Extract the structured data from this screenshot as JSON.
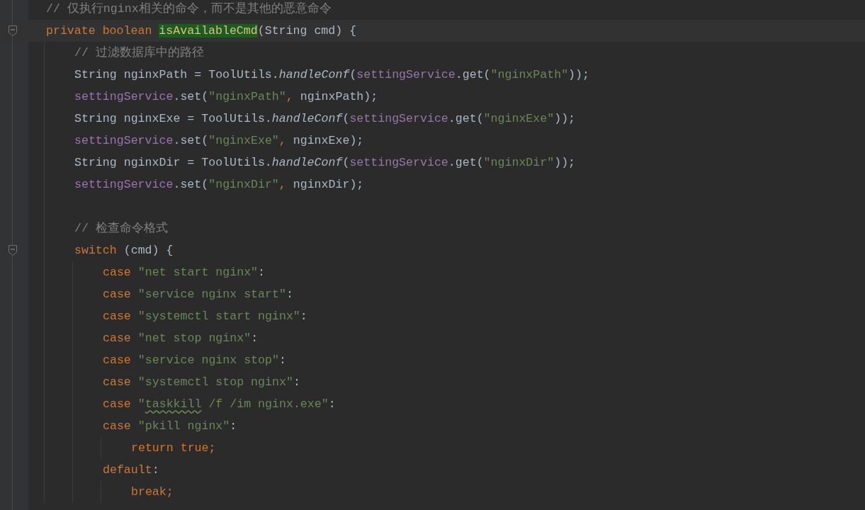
{
  "editor": {
    "lines": [
      {
        "tokens": [
          {
            "kind": "comment",
            "text": "// 仅执行nginx相关的命令，而不是其他的恶意命令"
          }
        ]
      },
      {
        "current": true,
        "foldable": true,
        "tokens": [
          {
            "kind": "keyword",
            "text": "private boolean "
          },
          {
            "kind": "plain",
            "text": "isAvailableCmd",
            "highlighted": true
          },
          {
            "kind": "plain",
            "text": "(String cmd) {"
          }
        ],
        "children": [
          {
            "tokens": [
              {
                "kind": "comment",
                "text": "// 过滤数据库中的路径"
              }
            ]
          },
          {
            "tokens": [
              {
                "kind": "plain",
                "text": "String nginxPath = ToolUtils."
              },
              {
                "kind": "static",
                "text": "handleConf"
              },
              {
                "kind": "plain",
                "text": "("
              },
              {
                "kind": "field",
                "text": "settingService"
              },
              {
                "kind": "plain",
                "text": ".get("
              },
              {
                "kind": "string",
                "text": "\"nginxPath\""
              },
              {
                "kind": "plain",
                "text": "));"
              }
            ]
          },
          {
            "tokens": [
              {
                "kind": "field",
                "text": "settingService"
              },
              {
                "kind": "plain",
                "text": ".set("
              },
              {
                "kind": "string",
                "text": "\"nginxPath\""
              },
              {
                "kind": "keyword",
                "text": ", "
              },
              {
                "kind": "plain",
                "text": "nginxPath);"
              }
            ]
          },
          {
            "tokens": [
              {
                "kind": "plain",
                "text": "String nginxExe = ToolUtils."
              },
              {
                "kind": "static",
                "text": "handleConf"
              },
              {
                "kind": "plain",
                "text": "("
              },
              {
                "kind": "field",
                "text": "settingService"
              },
              {
                "kind": "plain",
                "text": ".get("
              },
              {
                "kind": "string",
                "text": "\"nginxExe\""
              },
              {
                "kind": "plain",
                "text": "));"
              }
            ]
          },
          {
            "tokens": [
              {
                "kind": "field",
                "text": "settingService"
              },
              {
                "kind": "plain",
                "text": ".set("
              },
              {
                "kind": "string",
                "text": "\"nginxExe\""
              },
              {
                "kind": "keyword",
                "text": ", "
              },
              {
                "kind": "plain",
                "text": "nginxExe);"
              }
            ]
          },
          {
            "tokens": [
              {
                "kind": "plain",
                "text": "String nginxDir = ToolUtils."
              },
              {
                "kind": "static",
                "text": "handleConf"
              },
              {
                "kind": "plain",
                "text": "("
              },
              {
                "kind": "field",
                "text": "settingService"
              },
              {
                "kind": "plain",
                "text": ".get("
              },
              {
                "kind": "string",
                "text": "\"nginxDir\""
              },
              {
                "kind": "plain",
                "text": "));"
              }
            ]
          },
          {
            "tokens": [
              {
                "kind": "field",
                "text": "settingService"
              },
              {
                "kind": "plain",
                "text": ".set("
              },
              {
                "kind": "string",
                "text": "\"nginxDir\""
              },
              {
                "kind": "keyword",
                "text": ", "
              },
              {
                "kind": "plain",
                "text": "nginxDir);"
              }
            ]
          },
          {
            "gap_before": true,
            "tokens": [
              {
                "kind": "comment",
                "text": "// 检查命令格式"
              }
            ]
          },
          {
            "foldable": true,
            "tokens": [
              {
                "kind": "keyword",
                "text": "switch "
              },
              {
                "kind": "plain",
                "text": "(cmd) {"
              }
            ],
            "children": [
              {
                "tokens": [
                  {
                    "kind": "keyword",
                    "text": "case "
                  },
                  {
                    "kind": "string",
                    "text": "\"net start nginx\""
                  },
                  {
                    "kind": "plain",
                    "text": ":"
                  }
                ]
              },
              {
                "tokens": [
                  {
                    "kind": "keyword",
                    "text": "case "
                  },
                  {
                    "kind": "string",
                    "text": "\"service nginx start\""
                  },
                  {
                    "kind": "plain",
                    "text": ":"
                  }
                ]
              },
              {
                "tokens": [
                  {
                    "kind": "keyword",
                    "text": "case "
                  },
                  {
                    "kind": "string",
                    "text": "\"systemctl start nginx\""
                  },
                  {
                    "kind": "plain",
                    "text": ":"
                  }
                ]
              },
              {
                "tokens": [
                  {
                    "kind": "keyword",
                    "text": "case "
                  },
                  {
                    "kind": "string",
                    "text": "\"net stop nginx\""
                  },
                  {
                    "kind": "plain",
                    "text": ":"
                  }
                ]
              },
              {
                "tokens": [
                  {
                    "kind": "keyword",
                    "text": "case "
                  },
                  {
                    "kind": "string",
                    "text": "\"service nginx stop\""
                  },
                  {
                    "kind": "plain",
                    "text": ":"
                  }
                ]
              },
              {
                "tokens": [
                  {
                    "kind": "keyword",
                    "text": "case "
                  },
                  {
                    "kind": "string",
                    "text": "\"systemctl stop nginx\""
                  },
                  {
                    "kind": "plain",
                    "text": ":"
                  }
                ]
              },
              {
                "tokens": [
                  {
                    "kind": "keyword",
                    "text": "case "
                  },
                  {
                    "kind": "string",
                    "text": "\""
                  },
                  {
                    "kind": "string",
                    "text": "taskkill",
                    "misspelled": true
                  },
                  {
                    "kind": "string",
                    "text": " /f /im nginx.exe\""
                  },
                  {
                    "kind": "plain",
                    "text": ":"
                  }
                ]
              },
              {
                "tokens": [
                  {
                    "kind": "keyword",
                    "text": "case "
                  },
                  {
                    "kind": "string",
                    "text": "\"pkill nginx\""
                  },
                  {
                    "kind": "plain",
                    "text": ":"
                  }
                ],
                "children": [
                  {
                    "tokens": [
                      {
                        "kind": "keyword",
                        "text": "return true;"
                      }
                    ]
                  }
                ]
              },
              {
                "tokens": [
                  {
                    "kind": "keyword",
                    "text": "default"
                  },
                  {
                    "kind": "plain",
                    "text": ":"
                  }
                ],
                "children": [
                  {
                    "tokens": [
                      {
                        "kind": "keyword",
                        "text": "break;"
                      }
                    ]
                  }
                ]
              }
            ]
          }
        ]
      }
    ]
  }
}
